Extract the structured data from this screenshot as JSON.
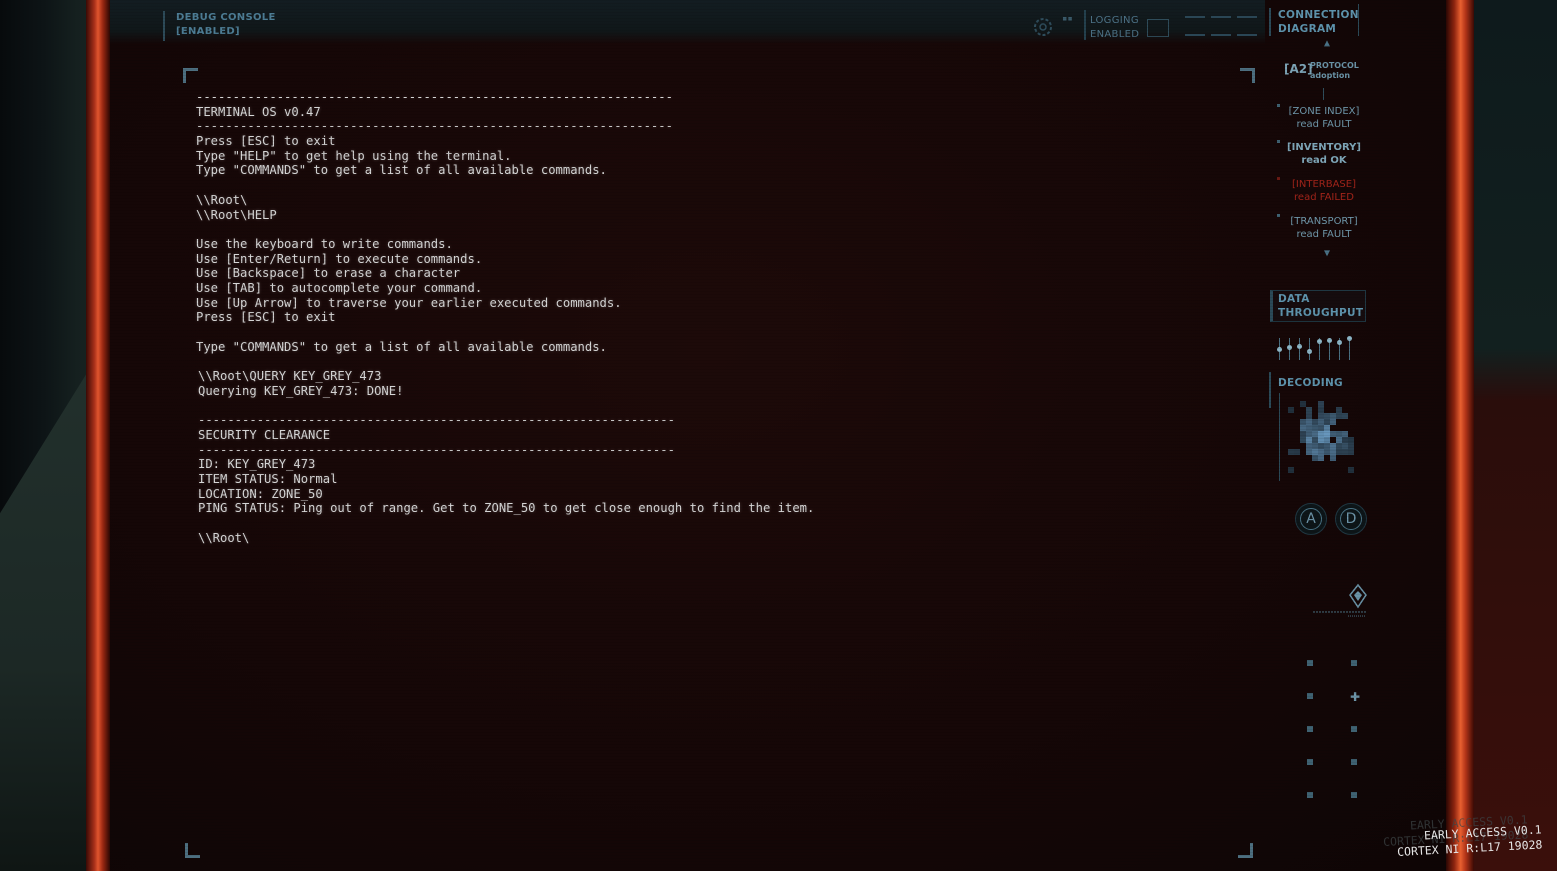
{
  "header": {
    "debug_console_line1": "DEBUG CONSOLE",
    "debug_console_line2": "[ENABLED]",
    "logging_line1": "LOGGING",
    "logging_line2": "ENABLED"
  },
  "terminal": {
    "lines": [
      "-----------------------------------------------------------------",
      "TERMINAL OS v0.47",
      "-----------------------------------------------------------------",
      "Press [ESC] to exit",
      "Type \"HELP\" to get help using the terminal.",
      "Type \"COMMANDS\" to get a list of all available commands.",
      "",
      "\\\\Root\\",
      "\\\\Root\\HELP",
      "",
      "Use the keyboard to write commands.",
      "Use [Enter/Return] to execute commands.",
      "Use [Backspace] to erase a character",
      "Use [TAB] to autocomplete your command.",
      "Use [Up Arrow] to traverse your earlier executed commands.",
      "Press [ESC] to exit",
      "",
      "Type \"COMMANDS\" to get a list of all available commands.",
      "",
      "\\\\Root\\QUERY KEY_GREY_473",
      "Querying KEY_GREY_473: DONE!",
      "",
      "-----------------------------------------------------------------",
      "SECURITY CLEARANCE",
      "-----------------------------------------------------------------",
      "ID: KEY_GREY_473",
      "ITEM STATUS: Normal",
      "LOCATION: ZONE_50",
      "PING STATUS: Ping out of range. Get to ZONE_50 to get close enough to find the item.",
      "",
      "\\\\Root\\"
    ]
  },
  "panel": {
    "connection_title_1": "CONNECTION",
    "connection_title_2": "DIAGRAM",
    "a2_label": "[A2]",
    "a2_sub_1": "PROTOCOL",
    "a2_sub_2": "adoption",
    "items": [
      {
        "name": "[ZONE INDEX]",
        "status": "read FAULT"
      },
      {
        "name": "[INVENTORY]",
        "status": "read OK"
      },
      {
        "name": "[INTERBASE]",
        "status": "read FAILED"
      },
      {
        "name": "[TRANSPORT]",
        "status": "read FAULT"
      }
    ],
    "throughput_1": "DATA",
    "throughput_2": "THROUGHPUT",
    "decoding": "DECODING",
    "button_a": "A",
    "button_d": "D",
    "failed_color": "#a3241a"
  },
  "watermark": {
    "line1": "EARLY ACCESS V0.1",
    "line2": "CORTEX NI R:L17 19028"
  }
}
